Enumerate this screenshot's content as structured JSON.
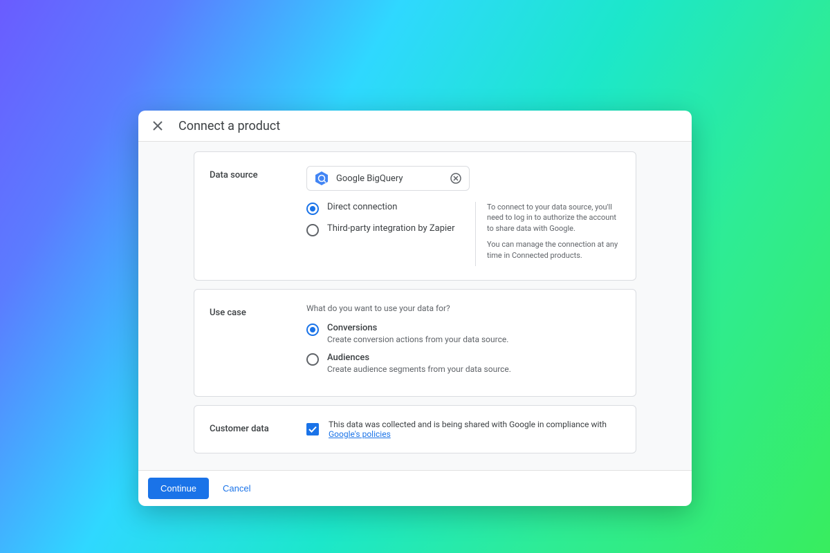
{
  "dialog": {
    "title": "Connect a product"
  },
  "data_source": {
    "section_label": "Data source",
    "selected_name": "Google BigQuery",
    "options": {
      "direct": "Direct connection",
      "zapier": "Third-party integration by Zapier"
    },
    "help": {
      "line1": "To connect to your data source, you'll need to log in to authorize the account to share data with Google.",
      "line2": "You can manage the connection at any time in Connected products."
    }
  },
  "use_case": {
    "section_label": "Use case",
    "prompt": "What do you want to use your data for?",
    "options": {
      "conversions": {
        "title": "Conversions",
        "desc": "Create conversion actions from your data source."
      },
      "audiences": {
        "title": "Audiences",
        "desc": "Create audience segments from your data source."
      }
    }
  },
  "customer_data": {
    "section_label": "Customer data",
    "compliance_text": "This data was collected and is being shared with Google in compliance with ",
    "policy_link_text": "Google's policies"
  },
  "footer": {
    "continue": "Continue",
    "cancel": "Cancel"
  }
}
